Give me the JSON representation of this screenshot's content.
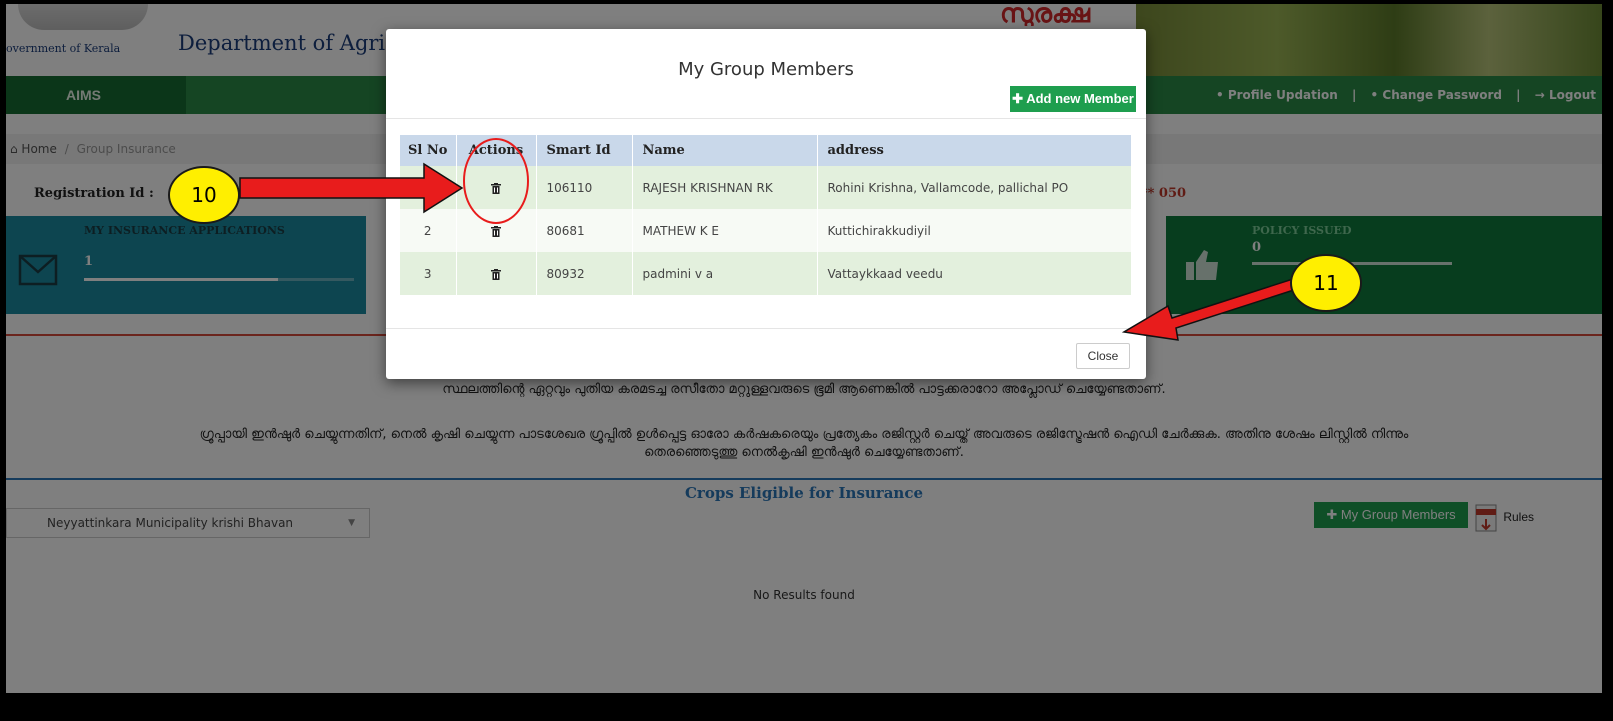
{
  "header": {
    "gov_text": "overnment of Kerala",
    "dept_text": "Department of Agri",
    "logo_text": "സുരക്ഷ"
  },
  "nav": {
    "brand": "AIMS",
    "profile": "• Profile Updation",
    "sep1": "|",
    "change_password": "• Change Password",
    "sep2": "|",
    "logout": "→ Logout"
  },
  "breadcrumb": {
    "home": "⌂ Home",
    "sep": "/",
    "current": "Group Insurance"
  },
  "registration": {
    "label": "Registration Id :",
    "value": "*** 050"
  },
  "tiles": {
    "left": {
      "title": "MY INSURANCE APPLICATIONS",
      "value": "1"
    },
    "right": {
      "title": "POLICY ISSUED",
      "value": "0"
    }
  },
  "notices": {
    "line1": "സ്ഥലത്തിന്റെ ഏറ്റവും പുതിയ കരമടച്ച രസീതോ മറ്റുള്ളവരുടെ ഭൂമി ആണെങ്കിൽ പാട്ടക്കരാറോ അപ്ലോഡ് ചെയ്യേണ്ടതാണ്.",
    "line2a": "ഗ്രൂപ്പായി ഇൻഷുർ ചെയ്യുന്നതിന്, നെൽ കൃഷി ചെയ്യുന്ന പാടശേഖര ഗ്രൂപ്പിൽ ഉൾപ്പെട്ട ഓരോ കർഷകരെയും പ്രത്യേകം രജിസ്റ്റർ ചെയ്ത് അവരുടെ രജിസ്ട്രേഷൻ ഐഡി ചേർക്കുക. അതിനു ശേഷം ലിസ്റ്റിൽ നിന്നും",
    "line2b": "തെരഞ്ഞെടുത്തു നെൽകൃഷി ഇൻഷുർ ചെയ്യേണ്ടതാണ്."
  },
  "crops": {
    "title": "Crops Eligible for Insurance",
    "select_value": "Neyyattinkara Municipality krishi Bhavan",
    "group_members_btn": "✚ My Group Members",
    "rules": "Rules",
    "no_results": "No Results found"
  },
  "modal": {
    "title": "My Group Members",
    "add_btn": "✚ Add new Member",
    "columns": [
      "Sl No",
      "Actions",
      "Smart Id",
      "Name",
      "address"
    ],
    "rows": [
      {
        "sl": "1",
        "smart_id": "106110",
        "name": "RAJESH KRISHNAN RK",
        "address": "Rohini Krishna, Vallamcode, pallichal PO"
      },
      {
        "sl": "2",
        "smart_id": "80681",
        "name": "MATHEW K E",
        "address": "Kuttichirakkudiyil"
      },
      {
        "sl": "3",
        "smart_id": "80932",
        "name": "padmini v a",
        "address": "Vattaykkaad veedu"
      }
    ],
    "close_btn": "Close"
  },
  "annotations": {
    "callout_10": "10",
    "callout_11": "11",
    "arrow_color": "#e81c1c",
    "callout_color": "#ffef00"
  }
}
